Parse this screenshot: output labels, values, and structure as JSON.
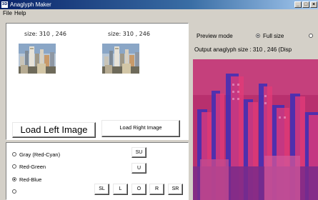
{
  "window": {
    "title": "Anaglyph Maker",
    "icon_label": "3D",
    "controls": [
      "_",
      "□",
      "×"
    ]
  },
  "menu": [
    "File",
    "Help"
  ],
  "left_image": {
    "size_label": "size: 310 , 246"
  },
  "right_image": {
    "size_label": "size: 310 , 246"
  },
  "buttons": {
    "load_left": "Load Left Image",
    "load_right": "Load Right Image"
  },
  "color_modes": [
    {
      "label": "Gray (Red-Cyan)",
      "selected": false
    },
    {
      "label": "Red-Green",
      "selected": false
    },
    {
      "label": "Red-Blue",
      "selected": true
    },
    {
      "label": "",
      "selected": false
    }
  ],
  "shift_buttons": {
    "su": "SU",
    "u": "U",
    "sl": "SL",
    "l": "L",
    "o": "O",
    "r": "R",
    "sr": "SR"
  },
  "preview": {
    "mode_label": "Preview mode",
    "full_size_label": "Full size",
    "full_size_selected": true,
    "output_label": "Output anaglyph size : 310 , 246 (Disp"
  },
  "colors": {
    "titlebar_start": "#0a246a",
    "titlebar_end": "#a6caf0",
    "anaglyph_red": "#e0306a",
    "anaglyph_blue": "#3a2ec0"
  }
}
